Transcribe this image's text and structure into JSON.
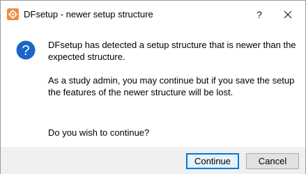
{
  "window": {
    "title": "DFsetup - newer setup structure",
    "help_label": "?",
    "close_icon": "close-icon",
    "app_icon": "dfsetup-app-icon"
  },
  "message": {
    "icon": "question-icon",
    "line1": "DFsetup has detected a setup structure that is newer than the expected structure.",
    "line2": "As a study admin, you may continue but if you save the setup the features of the newer structure will be lost.",
    "line3": "Do you wish to continue?"
  },
  "buttons": {
    "continue_label": "Continue",
    "cancel_label": "Cancel"
  },
  "colors": {
    "accent": "#0078d7",
    "question_icon": "#1a66c7",
    "app_icon": "#f08a3c"
  }
}
